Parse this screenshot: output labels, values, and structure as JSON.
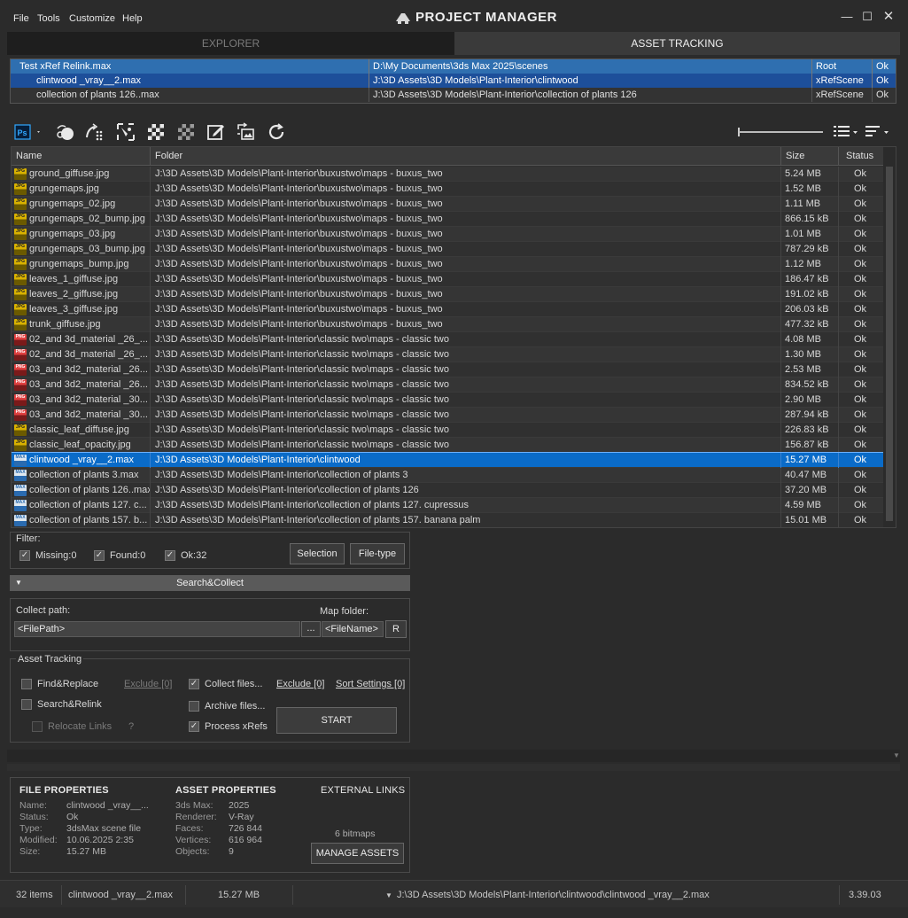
{
  "menu": [
    "File",
    "Tools",
    "Customize",
    "Help"
  ],
  "app_title": "PROJECT MANAGER",
  "tabs": {
    "explorer": "EXPLORER",
    "asset_tracking": "ASSET TRACKING"
  },
  "scenes": [
    {
      "name": "Test xRef Relink.max",
      "path": "D:\\My Documents\\3ds Max 2025\\scenes",
      "type": "Root",
      "status": "Ok"
    },
    {
      "name": "clintwood _vray__2.max",
      "path": "J:\\3D Assets\\3D Models\\Plant-Interior\\clintwood",
      "type": "xRefScene",
      "status": "Ok"
    },
    {
      "name": "collection of plants 126..max",
      "path": "J:\\3D Assets\\3D Models\\Plant-Interior\\collection of plants 126",
      "type": "xRefScene",
      "status": "Ok"
    }
  ],
  "table": {
    "headers": {
      "name": "Name",
      "folder": "Folder",
      "size": "Size",
      "status": "Status"
    },
    "rows": [
      {
        "icon": "jpg",
        "name": "ground_giffuse.jpg",
        "folder": "J:\\3D Assets\\3D Models\\Plant-Interior\\buxustwo\\maps - buxus_two",
        "size": "5.24 MB",
        "status": "Ok"
      },
      {
        "icon": "jpg",
        "name": "grungemaps.jpg",
        "folder": "J:\\3D Assets\\3D Models\\Plant-Interior\\buxustwo\\maps - buxus_two",
        "size": "1.52 MB",
        "status": "Ok"
      },
      {
        "icon": "jpg",
        "name": "grungemaps_02.jpg",
        "folder": "J:\\3D Assets\\3D Models\\Plant-Interior\\buxustwo\\maps - buxus_two",
        "size": "1.11 MB",
        "status": "Ok"
      },
      {
        "icon": "jpg",
        "name": "grungemaps_02_bump.jpg",
        "folder": "J:\\3D Assets\\3D Models\\Plant-Interior\\buxustwo\\maps - buxus_two",
        "size": "866.15 kB",
        "status": "Ok"
      },
      {
        "icon": "jpg",
        "name": "grungemaps_03.jpg",
        "folder": "J:\\3D Assets\\3D Models\\Plant-Interior\\buxustwo\\maps - buxus_two",
        "size": "1.01 MB",
        "status": "Ok"
      },
      {
        "icon": "jpg",
        "name": "grungemaps_03_bump.jpg",
        "folder": "J:\\3D Assets\\3D Models\\Plant-Interior\\buxustwo\\maps - buxus_two",
        "size": "787.29 kB",
        "status": "Ok"
      },
      {
        "icon": "jpg",
        "name": "grungemaps_bump.jpg",
        "folder": "J:\\3D Assets\\3D Models\\Plant-Interior\\buxustwo\\maps - buxus_two",
        "size": "1.12 MB",
        "status": "Ok"
      },
      {
        "icon": "jpg",
        "name": "leaves_1_giffuse.jpg",
        "folder": "J:\\3D Assets\\3D Models\\Plant-Interior\\buxustwo\\maps - buxus_two",
        "size": "186.47 kB",
        "status": "Ok"
      },
      {
        "icon": "jpg",
        "name": "leaves_2_giffuse.jpg",
        "folder": "J:\\3D Assets\\3D Models\\Plant-Interior\\buxustwo\\maps - buxus_two",
        "size": "191.02 kB",
        "status": "Ok"
      },
      {
        "icon": "jpg",
        "name": "leaves_3_giffuse.jpg",
        "folder": "J:\\3D Assets\\3D Models\\Plant-Interior\\buxustwo\\maps - buxus_two",
        "size": "206.03 kB",
        "status": "Ok"
      },
      {
        "icon": "jpg",
        "name": "trunk_giffuse.jpg",
        "folder": "J:\\3D Assets\\3D Models\\Plant-Interior\\buxustwo\\maps - buxus_two",
        "size": "477.32 kB",
        "status": "Ok"
      },
      {
        "icon": "png",
        "name": "02_and 3d_material _26_...",
        "folder": "J:\\3D Assets\\3D Models\\Plant-Interior\\classic two\\maps - classic two",
        "size": "4.08 MB",
        "status": "Ok"
      },
      {
        "icon": "png",
        "name": "02_and 3d_material _26_...",
        "folder": "J:\\3D Assets\\3D Models\\Plant-Interior\\classic two\\maps - classic two",
        "size": "1.30 MB",
        "status": "Ok"
      },
      {
        "icon": "png",
        "name": "03_and 3d2_material _26...",
        "folder": "J:\\3D Assets\\3D Models\\Plant-Interior\\classic two\\maps - classic two",
        "size": "2.53 MB",
        "status": "Ok"
      },
      {
        "icon": "png",
        "name": "03_and 3d2_material _26...",
        "folder": "J:\\3D Assets\\3D Models\\Plant-Interior\\classic two\\maps - classic two",
        "size": "834.52 kB",
        "status": "Ok"
      },
      {
        "icon": "png",
        "name": "03_and 3d2_material _30...",
        "folder": "J:\\3D Assets\\3D Models\\Plant-Interior\\classic two\\maps - classic two",
        "size": "2.90 MB",
        "status": "Ok"
      },
      {
        "icon": "png",
        "name": "03_and 3d2_material _30...",
        "folder": "J:\\3D Assets\\3D Models\\Plant-Interior\\classic two\\maps - classic two",
        "size": "287.94 kB",
        "status": "Ok"
      },
      {
        "icon": "jpg",
        "name": "classic_leaf_diffuse.jpg",
        "folder": "J:\\3D Assets\\3D Models\\Plant-Interior\\classic two\\maps - classic two",
        "size": "226.83 kB",
        "status": "Ok"
      },
      {
        "icon": "jpg",
        "name": "classic_leaf_opacity.jpg",
        "folder": "J:\\3D Assets\\3D Models\\Plant-Interior\\classic two\\maps - classic two",
        "size": "156.87 kB",
        "status": "Ok"
      },
      {
        "icon": "max",
        "name": "clintwood _vray__2.max",
        "folder": "J:\\3D Assets\\3D Models\\Plant-Interior\\clintwood",
        "size": "15.27 MB",
        "status": "Ok",
        "selected": true
      },
      {
        "icon": "max",
        "name": "collection of plants 3.max",
        "folder": "J:\\3D Assets\\3D Models\\Plant-Interior\\collection of plants 3",
        "size": "40.47 MB",
        "status": "Ok"
      },
      {
        "icon": "max",
        "name": "collection of plants 126..max",
        "folder": "J:\\3D Assets\\3D Models\\Plant-Interior\\collection of plants 126",
        "size": "37.20 MB",
        "status": "Ok"
      },
      {
        "icon": "max",
        "name": "collection of plants 127. c...",
        "folder": "J:\\3D Assets\\3D Models\\Plant-Interior\\collection of plants 127. cupressus",
        "size": "4.59 MB",
        "status": "Ok"
      },
      {
        "icon": "max",
        "name": "collection of plants 157. b...",
        "folder": "J:\\3D Assets\\3D Models\\Plant-Interior\\collection of plants 157. banana palm",
        "size": "15.01 MB",
        "status": "Ok"
      }
    ]
  },
  "filter": {
    "title": "Filter:",
    "missing": "Missing:0",
    "found": "Found:0",
    "ok": "Ok:32",
    "selection_btn": "Selection",
    "filetype_btn": "File-type"
  },
  "search_collect": "Search&Collect",
  "collect": {
    "path_label": "Collect path:",
    "map_label": "Map folder:",
    "path_value": "<FilePath>",
    "browse_btn": "...",
    "map_value": "<FileName>",
    "reset_btn": "R"
  },
  "tracking": {
    "title": "Asset Tracking",
    "find_replace": "Find&Replace",
    "exclude1": "Exclude [0]",
    "search_relink": "Search&Relink",
    "relocate": "Relocate Links",
    "help": "?",
    "collect_files": "Collect files...",
    "exclude2": "Exclude [0]",
    "sort_settings": "Sort Settings [0]",
    "archive_files": "Archive files...",
    "process_xrefs": "Process xRefs",
    "start": "START"
  },
  "file_props": {
    "title": "FILE PROPERTIES",
    "name_l": "Name:",
    "name_v": "clintwood _vray__...",
    "status_l": "Status:",
    "status_v": "Ok",
    "type_l": "Type:",
    "type_v": "3dsMax scene file",
    "modified_l": "Modified:",
    "modified_v": "10.06.2025 2:35",
    "size_l": "Size:",
    "size_v": "15.27 MB"
  },
  "asset_props": {
    "title": "ASSET PROPERTIES",
    "max_l": "3ds Max:",
    "max_v": "2025",
    "renderer_l": "Renderer:",
    "renderer_v": "V-Ray",
    "faces_l": "Faces:",
    "faces_v": "726 844",
    "vertices_l": "Vertices:",
    "vertices_v": "616 964",
    "objects_l": "Objects:",
    "objects_v": "9"
  },
  "external": {
    "title": "EXTERNAL LINKS",
    "bitmaps": "6 bitmaps",
    "manage_btn": "MANAGE ASSETS"
  },
  "status_bar": {
    "items": "32 items",
    "file": "clintwood _vray__2.max",
    "size": "15.27 MB",
    "path": "J:\\3D Assets\\3D Models\\Plant-Interior\\clintwood\\clintwood _vray__2.max",
    "version": "3.39.03"
  }
}
